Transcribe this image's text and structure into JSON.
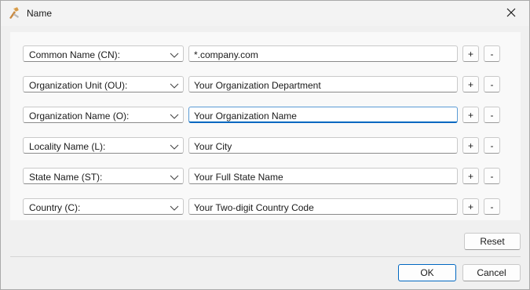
{
  "window": {
    "title": "Name",
    "app_icon": "certificate-app-icon",
    "close_icon": "close-icon"
  },
  "rows": [
    {
      "attribute": "Common Name (CN):",
      "value": "*.company.com",
      "focused": false
    },
    {
      "attribute": "Organization Unit (OU):",
      "value": "Your Organization Department",
      "focused": false
    },
    {
      "attribute": "Organization Name (O):",
      "value": "Your Organization Name",
      "focused": true
    },
    {
      "attribute": "Locality Name (L):",
      "value": "Your City",
      "focused": false
    },
    {
      "attribute": "State Name (ST):",
      "value": "Your Full State Name",
      "focused": false
    },
    {
      "attribute": "Country (C):",
      "value": "Your Two-digit Country Code",
      "focused": false
    }
  ],
  "row_buttons": {
    "add": "+",
    "remove": "-"
  },
  "buttons": {
    "reset": "Reset",
    "ok": "OK",
    "cancel": "Cancel"
  },
  "colors": {
    "accent": "#0067c0",
    "focus_border": "#5b9bd5"
  }
}
